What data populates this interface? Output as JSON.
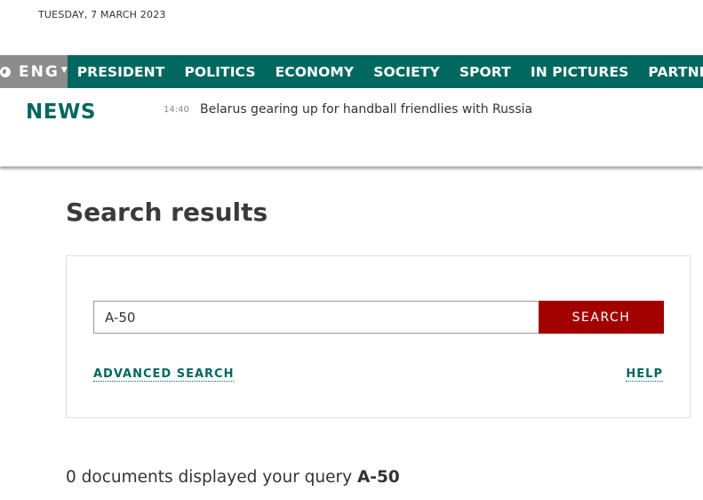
{
  "header": {
    "date": "TUESDAY, 7 MARCH 2023"
  },
  "nav": {
    "language": "ENG",
    "items": [
      "PRESIDENT",
      "POLITICS",
      "ECONOMY",
      "SOCIETY",
      "SPORT",
      "IN PICTURES",
      "PARTNERS"
    ]
  },
  "news": {
    "label": "NEWS",
    "ticker_time": "14:40",
    "ticker_text": "Belarus gearing up for handball friendlies with Russia"
  },
  "main": {
    "title": "Search results",
    "search": {
      "value": "A-50",
      "button_label": "SEARCH",
      "advanced_label": "ADVANCED SEARCH",
      "help_label": "HELP"
    },
    "result": {
      "prefix": "0 documents displayed your query",
      "query": "A-50"
    }
  },
  "colors": {
    "brand_green": "#00685f",
    "search_red": "#a30000",
    "lang_gray": "#8c8c8c"
  }
}
